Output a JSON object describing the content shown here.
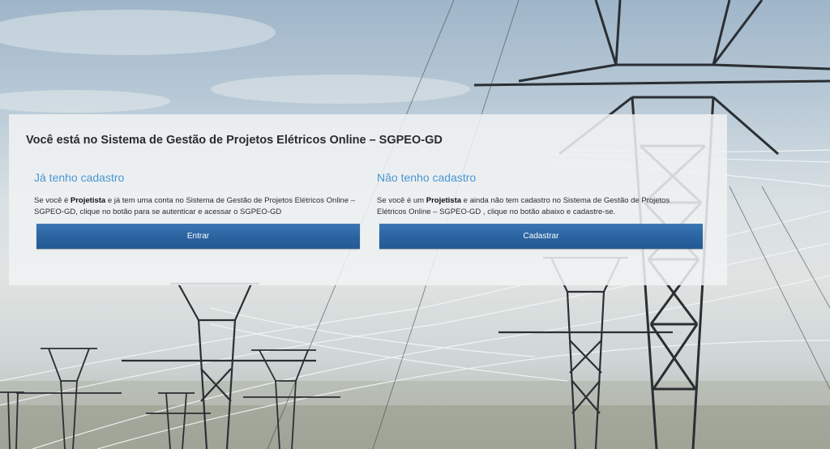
{
  "panel": {
    "title": "Você está no Sistema de Gestão de Projetos Elétricos Online – SGPEO-GD",
    "existing": {
      "heading": "Já tenho cadastro",
      "text_before": "Se você é ",
      "text_bold": "Projetista",
      "text_after": " e já tem uma conta no Sistema de Gestão de Projetos Elétricos Online – SGPEO-GD, clique no botão para se autenticar e acessar o SGPEO-GD",
      "button_label": "Entrar"
    },
    "new": {
      "heading": "Não tenho cadastro",
      "text_before": "Se você é um ",
      "text_bold": "Projetista",
      "text_after": " e ainda não tem cadastro no Sistema de Gestão de Projetos Elétricos Online – SGPEO-GD , clique no botão abaixo e cadastre-se.",
      "button_label": "Cadastrar"
    }
  },
  "colors": {
    "heading_blue": "#4a96d0",
    "button_blue": "#2a63a0",
    "panel_bg": "#f0f2f3"
  },
  "background": {
    "subject": "power-transmission-towers"
  }
}
